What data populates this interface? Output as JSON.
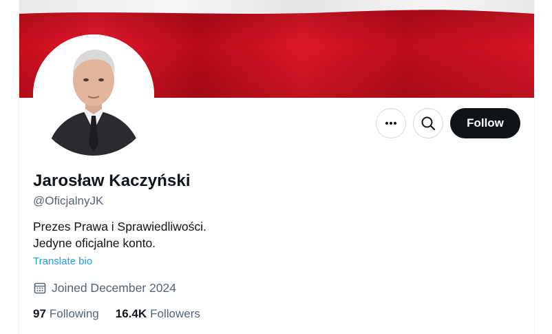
{
  "profile": {
    "display_name": "Jarosław Kaczyński",
    "handle": "@OficjalnyJK",
    "bio_line1": "Prezes Prawa i Sprawiedliwości.",
    "bio_line2": "Jedyne oficjalne konto.",
    "translate_bio": "Translate bio",
    "joined": "Joined December 2024"
  },
  "actions": {
    "more_icon": "more-horizontal-icon",
    "search_icon": "search-icon",
    "follow_label": "Follow"
  },
  "stats": {
    "following_count": "97",
    "following_label": "Following",
    "followers_count": "16.4K",
    "followers_label": "Followers"
  },
  "colors": {
    "banner_white": "#f4f4f4",
    "banner_red": "#d8121f",
    "follow_bg": "#0f1419",
    "link": "#1d9bf0",
    "secondary_text": "#536471"
  }
}
